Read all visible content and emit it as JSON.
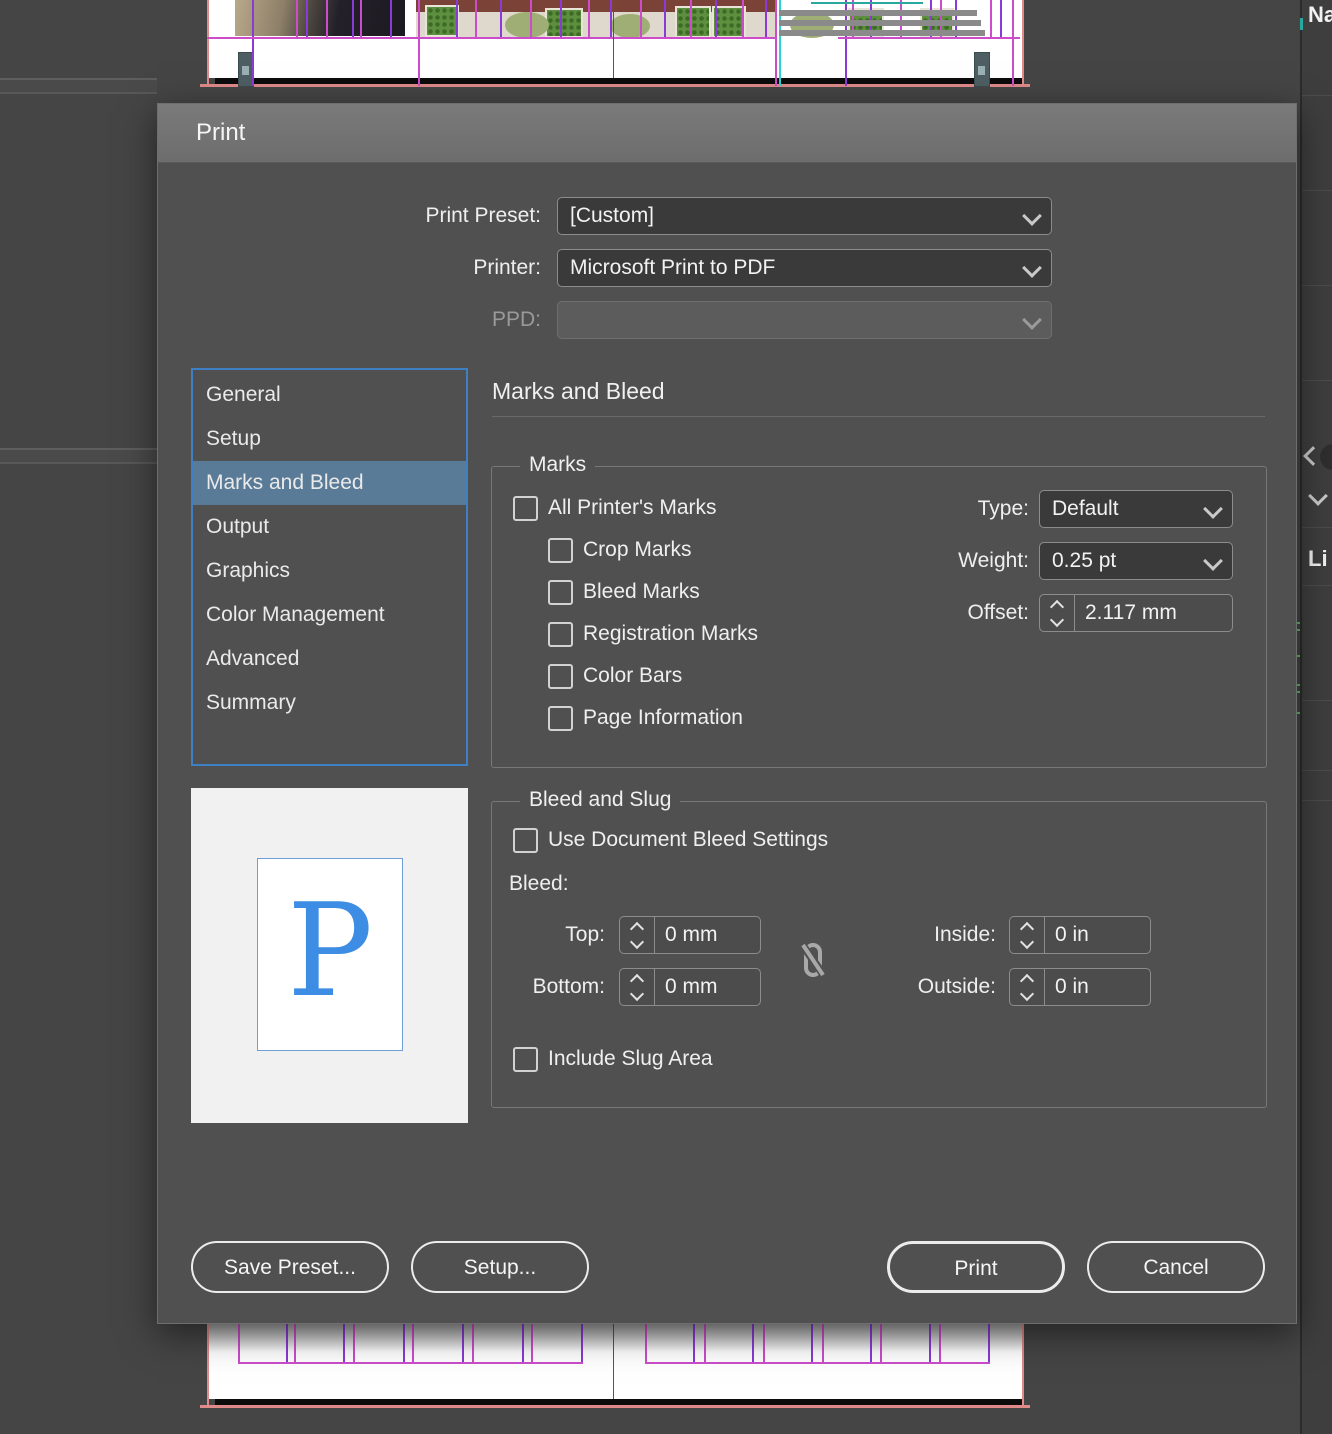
{
  "dialog": {
    "title": "Print",
    "fields": {
      "print_preset": {
        "label": "Print Preset:",
        "value": "[Custom]"
      },
      "printer": {
        "label": "Printer:",
        "value": "Microsoft Print to PDF"
      },
      "ppd": {
        "label": "PPD:",
        "value": ""
      }
    },
    "sidebar": {
      "selected": "Marks and Bleed",
      "items": [
        {
          "label": "General"
        },
        {
          "label": "Setup"
        },
        {
          "label": "Marks and Bleed"
        },
        {
          "label": "Output"
        },
        {
          "label": "Graphics"
        },
        {
          "label": "Color Management"
        },
        {
          "label": "Advanced"
        },
        {
          "label": "Summary"
        }
      ]
    },
    "panel": {
      "heading": "Marks and Bleed",
      "marks": {
        "legend": "Marks",
        "checkboxes": [
          {
            "label": "All Printer's Marks",
            "checked": false
          },
          {
            "label": "Crop Marks",
            "checked": false
          },
          {
            "label": "Bleed Marks",
            "checked": false
          },
          {
            "label": "Registration Marks",
            "checked": false
          },
          {
            "label": "Color Bars",
            "checked": false
          },
          {
            "label": "Page Information",
            "checked": false
          }
        ],
        "type": {
          "label": "Type:",
          "value": "Default"
        },
        "weight": {
          "label": "Weight:",
          "value": "0.25 pt"
        },
        "offset": {
          "label": "Offset:",
          "value": "2.117 mm"
        }
      },
      "bleed_slug": {
        "legend": "Bleed and Slug",
        "use_document_bleed": {
          "label": "Use Document Bleed Settings",
          "checked": false
        },
        "bleed_label": "Bleed:",
        "top": {
          "label": "Top:",
          "value": "0 mm"
        },
        "bottom": {
          "label": "Bottom:",
          "value": "0 mm"
        },
        "inside": {
          "label": "Inside:",
          "value": "0 in"
        },
        "outside": {
          "label": "Outside:",
          "value": "0 in"
        },
        "include_slug": {
          "label": "Include Slug Area",
          "checked": false
        }
      },
      "preview_glyph": "P"
    },
    "buttons": {
      "save_preset": "Save Preset...",
      "setup": "Setup...",
      "print": "Print",
      "cancel": "Cancel"
    }
  },
  "background": {
    "right_panel": {
      "name_header": "Na",
      "links_header": "Li"
    }
  },
  "colors": {
    "selection_blue": "#597b97",
    "list_border_blue": "#3f80c4",
    "guide_magenta": "#cc4ccc",
    "guide_violet": "#8a3ad6",
    "bleed_pink": "#e08a8a",
    "guide_cyan": "#2ad4d4",
    "guide_teal": "#2aa79f",
    "tick_green": "#55c553",
    "preview_letter_blue": "#3d8de4"
  }
}
